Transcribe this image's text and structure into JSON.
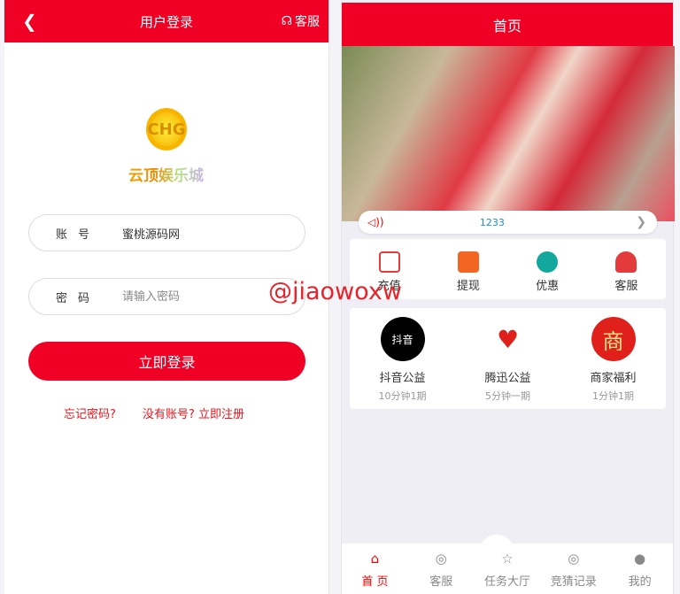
{
  "login": {
    "title": "用户登录",
    "service": "客服",
    "brand": "云顶娱乐城",
    "logo_text": "CHG",
    "account_label": "账号",
    "account_value": "蜜桃源码网",
    "password_label": "密码",
    "password_placeholder": "请输入密码",
    "submit": "立即登录",
    "forgot": "忘记密码?",
    "register": "没有账号? 立即注册"
  },
  "watermark": "@jiaowoxw",
  "home": {
    "title": "首页",
    "notice": "1233",
    "menu": [
      {
        "label": "充值",
        "icon": "card-icon",
        "color": "#e33b3b"
      },
      {
        "label": "提现",
        "icon": "coins-icon",
        "color": "#f26522"
      },
      {
        "label": "优惠",
        "icon": "exchange-icon",
        "color": "#13a89e"
      },
      {
        "label": "客服",
        "icon": "agent-icon",
        "color": "#e33b3b"
      }
    ],
    "products": [
      {
        "name": "抖音公益",
        "sub": "10分钟1期",
        "logo": "抖音",
        "color": "#000"
      },
      {
        "name": "腾迅公益",
        "sub": "5分钟一期",
        "logo": "♥",
        "color": "#fff"
      },
      {
        "name": "商家福利",
        "sub": "1分钟1期",
        "logo": "商",
        "color": "#e0201b"
      }
    ],
    "tabs": [
      {
        "label": "首 页",
        "icon": "home-icon"
      },
      {
        "label": "客服",
        "icon": "trophy-icon"
      },
      {
        "label": "任务大厅",
        "icon": "star-icon"
      },
      {
        "label": "竞猜记录",
        "icon": "trophy-icon"
      },
      {
        "label": "我的",
        "icon": "user-icon"
      }
    ]
  }
}
